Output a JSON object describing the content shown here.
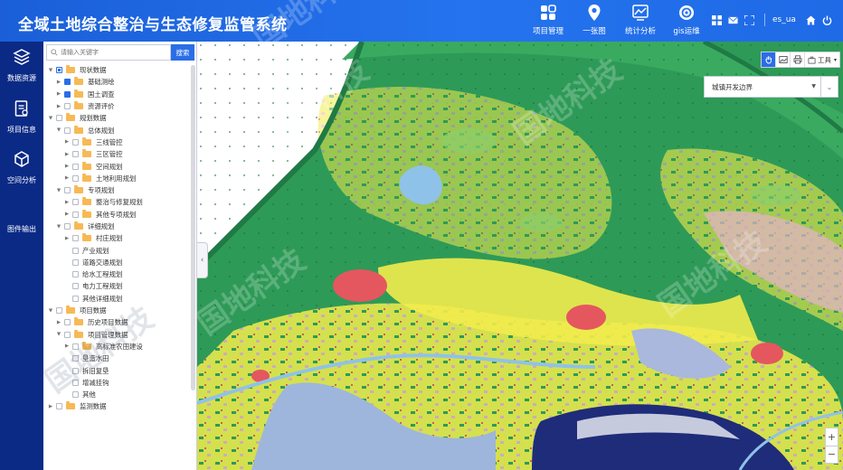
{
  "header": {
    "title": "全域土地综合整治与生态修复监管系统",
    "nav": [
      {
        "label": "项目管理",
        "icon": "grid-apps-icon"
      },
      {
        "label": "一张图",
        "icon": "map-pin-icon"
      },
      {
        "label": "统计分析",
        "icon": "chart-icon"
      },
      {
        "label": "gis运维",
        "icon": "gear-icon"
      }
    ],
    "username": "es_ua"
  },
  "sidebar": {
    "items": [
      {
        "label": "数据资源",
        "icon": "layers-icon"
      },
      {
        "label": "项目信息",
        "icon": "document-icon"
      },
      {
        "label": "空间分析",
        "icon": "cube-icon"
      },
      {
        "label": "图件输出",
        "icon": ""
      }
    ]
  },
  "panel": {
    "search_placeholder": "请输入关键字",
    "search_button": "搜索",
    "tree": [
      {
        "label": "现状数据",
        "level": 0,
        "expanded": true,
        "check": "part"
      },
      {
        "label": "基础测绘",
        "level": 1,
        "expanded": false,
        "check": "on"
      },
      {
        "label": "国土调查",
        "level": 1,
        "expanded": false,
        "check": "on"
      },
      {
        "label": "资源评价",
        "level": 1,
        "expanded": false,
        "check": "off"
      },
      {
        "label": "规划数据",
        "level": 0,
        "expanded": true,
        "check": "off"
      },
      {
        "label": "总体规划",
        "level": 1,
        "expanded": true,
        "check": "off"
      },
      {
        "label": "三线管控",
        "level": 2,
        "expanded": false,
        "check": "off"
      },
      {
        "label": "三区管控",
        "level": 2,
        "expanded": false,
        "check": "off"
      },
      {
        "label": "空间规划",
        "level": 2,
        "expanded": false,
        "check": "off"
      },
      {
        "label": "土地利用规划",
        "level": 2,
        "expanded": false,
        "check": "off"
      },
      {
        "label": "专项规划",
        "level": 1,
        "expanded": true,
        "check": "off"
      },
      {
        "label": "整治与修复规划",
        "level": 2,
        "expanded": false,
        "check": "off"
      },
      {
        "label": "其他专项规划",
        "level": 2,
        "expanded": false,
        "check": "off"
      },
      {
        "label": "详细规划",
        "level": 1,
        "expanded": true,
        "check": "off"
      },
      {
        "label": "村庄规划",
        "level": 2,
        "expanded": false,
        "check": "off"
      },
      {
        "label": "产业规划",
        "level": 2,
        "leaf": true,
        "check": "off"
      },
      {
        "label": "道路交通规划",
        "level": 2,
        "leaf": true,
        "check": "off"
      },
      {
        "label": "给水工程规划",
        "level": 2,
        "leaf": true,
        "check": "off"
      },
      {
        "label": "电力工程规划",
        "level": 2,
        "leaf": true,
        "check": "off"
      },
      {
        "label": "其他详细规划",
        "level": 2,
        "leaf": true,
        "check": "off"
      },
      {
        "label": "项目数据",
        "level": 0,
        "expanded": true,
        "check": "off"
      },
      {
        "label": "历史项目数据",
        "level": 1,
        "expanded": false,
        "check": "off"
      },
      {
        "label": "项目管理数据",
        "level": 1,
        "expanded": true,
        "check": "off"
      },
      {
        "label": "高标准农田建设",
        "level": 2,
        "expanded": false,
        "check": "off"
      },
      {
        "label": "垦造水田",
        "level": 2,
        "leaf": true,
        "check": "off"
      },
      {
        "label": "拆旧复垦",
        "level": 2,
        "leaf": true,
        "check": "off"
      },
      {
        "label": "增减挂钩",
        "level": 2,
        "leaf": true,
        "check": "off"
      },
      {
        "label": "其他",
        "level": 2,
        "leaf": true,
        "check": "off"
      },
      {
        "label": "监测数据",
        "level": 0,
        "expanded": false,
        "check": "off"
      }
    ]
  },
  "map": {
    "tools_label": "工具",
    "layer_select": "城镇开发边界",
    "zoom_in": "+",
    "zoom_out": "−",
    "watermark": "国地科技",
    "colors": {
      "forest": "#2e9a57",
      "dark_forest": "#1f7a45",
      "farmland": "#f2ec4c",
      "urban": "#e4575f",
      "water": "#8fc2e8",
      "wetland": "#a9b8dc",
      "grass": "#8bcf6a"
    }
  }
}
